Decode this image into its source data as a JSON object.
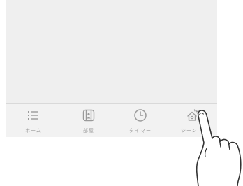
{
  "tabs": [
    {
      "label": "ホーム",
      "icon": "list-icon"
    },
    {
      "label": "部屋",
      "icon": "room-door-icon"
    },
    {
      "label": "タイマー",
      "icon": "clock-icon"
    },
    {
      "label": "シーン",
      "icon": "scene-house-icon"
    }
  ],
  "colors": {
    "screen_bg": "#efefef",
    "tabbar_bg": "#f2f2f2",
    "icon_gray": "#9a9a9a",
    "hand_outline": "#333333"
  }
}
